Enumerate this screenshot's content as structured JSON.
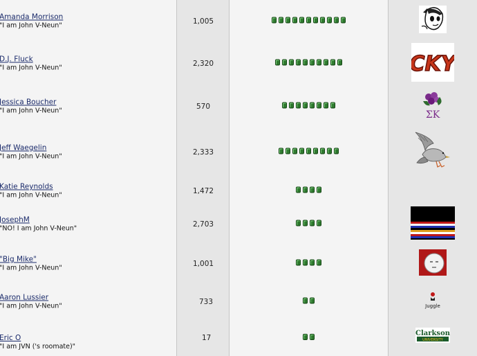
{
  "members": [
    {
      "name": "Amanda Morrison",
      "title": "\"I am John V-Neun\"",
      "posts": "1,005",
      "rank_pips": 11,
      "avatar": "cartoon-face-icon"
    },
    {
      "name": "D.J. Fluck",
      "title": "\"I am John V-Neun\"",
      "posts": "2,320",
      "rank_pips": 10,
      "avatar": "cky-logo-icon"
    },
    {
      "name": "Jessica Boucher",
      "title": "\"I am John V-Neun\"",
      "posts": "570",
      "rank_pips": 8,
      "avatar": "sigma-kappa-icon"
    },
    {
      "name": "Jeff Waegelin",
      "title": "\"I am John V-Neun\"",
      "posts": "2,333",
      "rank_pips": 9,
      "avatar": "bird-icon"
    },
    {
      "name": "Katie Reynolds",
      "title": "\"I am John V-Neun\"",
      "posts": "1,472",
      "rank_pips": 4,
      "avatar": ""
    },
    {
      "name": "JosephM",
      "title": "\"NO! I am John V-Neun\"",
      "posts": "2,703",
      "rank_pips": 4,
      "avatar": "striped-flag-icon"
    },
    {
      "name": "\"Big Mike\"",
      "title": "\"I am John V-Neun\"",
      "posts": "1,001",
      "rank_pips": 4,
      "avatar": "round-face-icon"
    },
    {
      "name": "Aaron Lussier",
      "title": "\"I am John V-Neun\"",
      "posts": "733",
      "rank_pips": 2,
      "avatar": "juggle-icon"
    },
    {
      "name": "Eric O",
      "title": "\"I am JVN ('s roomate)\"",
      "posts": "17",
      "rank_pips": 2,
      "avatar": "clarkson-university-logo"
    }
  ],
  "avatar_text": {
    "cky": "CKY",
    "sigma_kappa": "ΣK",
    "juggle": "Juggle",
    "clarkson_top": "Clarkson",
    "clarkson_bottom": "UNIVERSITY"
  },
  "colors": {
    "link": "#1a2a6a",
    "pip": "#2f7a2f",
    "cell_light": "#f4f4f4",
    "cell_dark": "#e6e6e6"
  }
}
